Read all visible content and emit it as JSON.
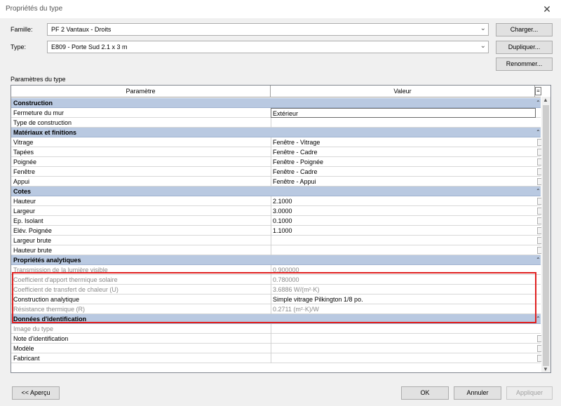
{
  "window": {
    "title": "Propriétés du type",
    "close_glyph": "✕"
  },
  "family": {
    "label": "Famille:",
    "value": "PF 2 Vantaux - Droits",
    "load_button": "Charger..."
  },
  "type": {
    "label": "Type:",
    "value": "E809 - Porte Sud 2.1 x 3 m",
    "duplicate_button": "Dupliquer...",
    "rename_button": "Renommer..."
  },
  "params_label": "Paramètres du type",
  "grid": {
    "col_param": "Paramètre",
    "col_value": "Valeur",
    "eq_glyph": "=",
    "groups": [
      {
        "title": "Construction",
        "rows": [
          {
            "p": "Fermeture du mur",
            "v": "Extérieur"
          },
          {
            "p": "Type de construction",
            "v": ""
          }
        ]
      },
      {
        "title": "Matériaux et finitions",
        "rows": [
          {
            "p": "Vitrage",
            "v": "Fenêtre - Vitrage"
          },
          {
            "p": "Tapées",
            "v": "Fenêtre - Cadre"
          },
          {
            "p": "Poignée",
            "v": "Fenêtre - Poignée"
          },
          {
            "p": "Fenêtre",
            "v": "Fenêtre - Cadre"
          },
          {
            "p": "Appui",
            "v": "Fenêtre - Appui"
          }
        ]
      },
      {
        "title": "Cotes",
        "rows": [
          {
            "p": "Hauteur",
            "v": "2.1000"
          },
          {
            "p": "Largeur",
            "v": "3.0000"
          },
          {
            "p": "Ep. Isolant",
            "v": "0.1000"
          },
          {
            "p": "Elév. Poignée",
            "v": "1.1000"
          },
          {
            "p": "Largeur brute",
            "v": ""
          },
          {
            "p": "Hauteur brute",
            "v": ""
          }
        ]
      },
      {
        "title": "Propriétés analytiques",
        "rows": [
          {
            "p": "Transmission de la lumière visible",
            "v": "0.900000"
          },
          {
            "p": "Coefficient d'apport thermique solaire",
            "v": "0.780000"
          },
          {
            "p": "Coefficient de transfert de chaleur (U)",
            "v": "3.6886 W/(m²·K)"
          },
          {
            "p": "Construction analytique",
            "v": "Simple vitrage Pilkington 1/8 po."
          },
          {
            "p": "Résistance thermique (R)",
            "v": "0.2711 (m²·K)/W"
          }
        ]
      },
      {
        "title": "Données d'identification",
        "rows": [
          {
            "p": "Image du type",
            "v": ""
          },
          {
            "p": "Note d'identification",
            "v": ""
          },
          {
            "p": "Modèle",
            "v": ""
          },
          {
            "p": "Fabricant",
            "v": ""
          }
        ]
      }
    ]
  },
  "footer": {
    "preview_button": "<< Aperçu",
    "ok_button": "OK",
    "cancel_button": "Annuler",
    "apply_button": "Appliquer"
  },
  "colors": {
    "group_header": "#b9c9e1",
    "highlight": "#e02020"
  }
}
